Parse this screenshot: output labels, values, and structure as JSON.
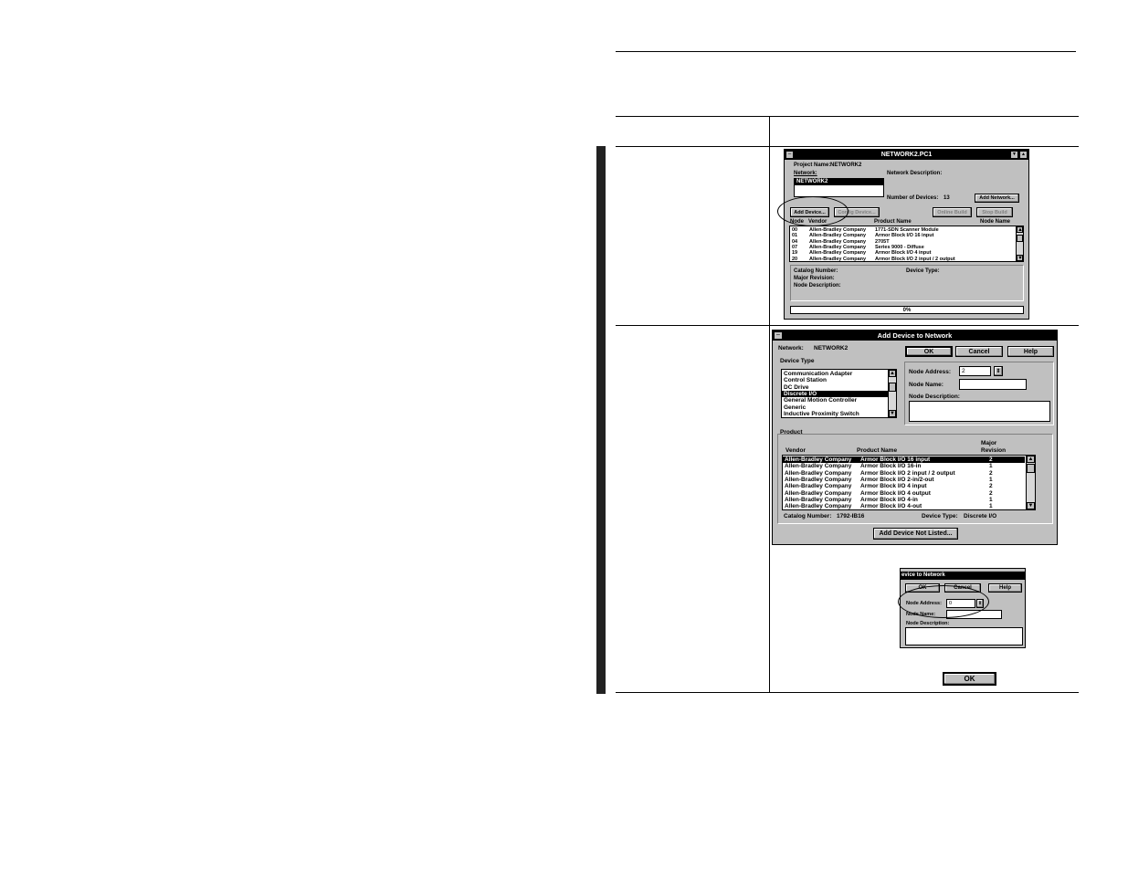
{
  "win1": {
    "title": "NETWORK2.PC1",
    "project_name_label": "Project Name:",
    "project_name": "NETWORK2",
    "network_label": "Network:",
    "network_selected": "NETWORK2",
    "network_desc_label": "Network Description:",
    "num_devices_label": "Number of Devices:",
    "num_devices": "13",
    "add_network": "Add Network...",
    "add_device": "Add Device...",
    "config_device": "Config Device...",
    "online_build": "Online Build",
    "stop_build": "Stop Build",
    "headers": {
      "node": "Node",
      "vendor": "Vendor",
      "product": "Product Name",
      "node_name": "Node Name"
    },
    "rows": [
      {
        "node": "00",
        "vendor": "Allen-Bradley Company",
        "product": "1771-SDN Scanner Module"
      },
      {
        "node": "01",
        "vendor": "Allen-Bradley Company",
        "product": "Armor Block I/O  16 input"
      },
      {
        "node": "04",
        "vendor": "Allen-Bradley Company",
        "product": "2705T"
      },
      {
        "node": "07",
        "vendor": "Allen-Bradley Company",
        "product": "Series 9000 - Diffuse"
      },
      {
        "node": "19",
        "vendor": "Allen-Bradley Company",
        "product": "Armor Block I/O  4 input"
      },
      {
        "node": "20",
        "vendor": "Allen-Bradley Company",
        "product": "Armor Block I/O  2 input / 2 output"
      }
    ],
    "catalog_label": "Catalog Number:",
    "device_type_label": "Device Type:",
    "major_rev_label": "Major Revision:",
    "node_desc_label": "Node Description:",
    "progress": "0%"
  },
  "win2": {
    "title": "Add Device to Network",
    "network_label": "Network:",
    "network_value": "NETWORK2",
    "ok": "OK",
    "cancel": "Cancel",
    "help": "Help",
    "device_type_label": "Device Type",
    "device_types": [
      "Communication Adapter",
      "Control Station",
      "DC Drive",
      "Discrete I/O",
      "General Motion Controller",
      "Generic",
      "Inductive Proximity Switch"
    ],
    "selected_device_type_index": 3,
    "node_address_label": "Node Address:",
    "node_address": "2",
    "node_name_label": "Node Name:",
    "node_desc_label": "Node Description:",
    "product_label": "Product",
    "headers": {
      "vendor": "Vendor",
      "product": "Product Name",
      "major": "Major",
      "revision": "Revision"
    },
    "products": [
      {
        "vendor": "Allen-Bradley Company",
        "product": "Armor Block I/O  16 input",
        "rev": "2"
      },
      {
        "vendor": "Allen-Bradley Company",
        "product": "Armor Block I/O  16-in",
        "rev": "1"
      },
      {
        "vendor": "Allen-Bradley Company",
        "product": "Armor Block I/O  2 input / 2 output",
        "rev": "2"
      },
      {
        "vendor": "Allen-Bradley Company",
        "product": "Armor Block I/O  2-in/2-out",
        "rev": "1"
      },
      {
        "vendor": "Allen-Bradley Company",
        "product": "Armor Block I/O  4 input",
        "rev": "2"
      },
      {
        "vendor": "Allen-Bradley Company",
        "product": "Armor Block I/O  4 output",
        "rev": "2"
      },
      {
        "vendor": "Allen-Bradley Company",
        "product": "Armor Block I/O  4-in",
        "rev": "1"
      },
      {
        "vendor": "Allen-Bradley Company",
        "product": "Armor Block I/O  4-out",
        "rev": "1"
      }
    ],
    "catalog_label": "Catalog Number:",
    "catalog_value": "1792-IB16",
    "device_type_label2": "Device Type:",
    "device_type_value": "Discrete I/O",
    "add_not_listed": "Add Device Not Listed..."
  },
  "win3": {
    "title": "evice to Network",
    "ok": "OK",
    "cancel": "Cancel",
    "help": "Help",
    "node_address_label": "Node Address:",
    "node_address": "0",
    "node_name_label": "Node Name:",
    "node_desc_label": "Node Description:"
  },
  "ok_standalone": "OK"
}
